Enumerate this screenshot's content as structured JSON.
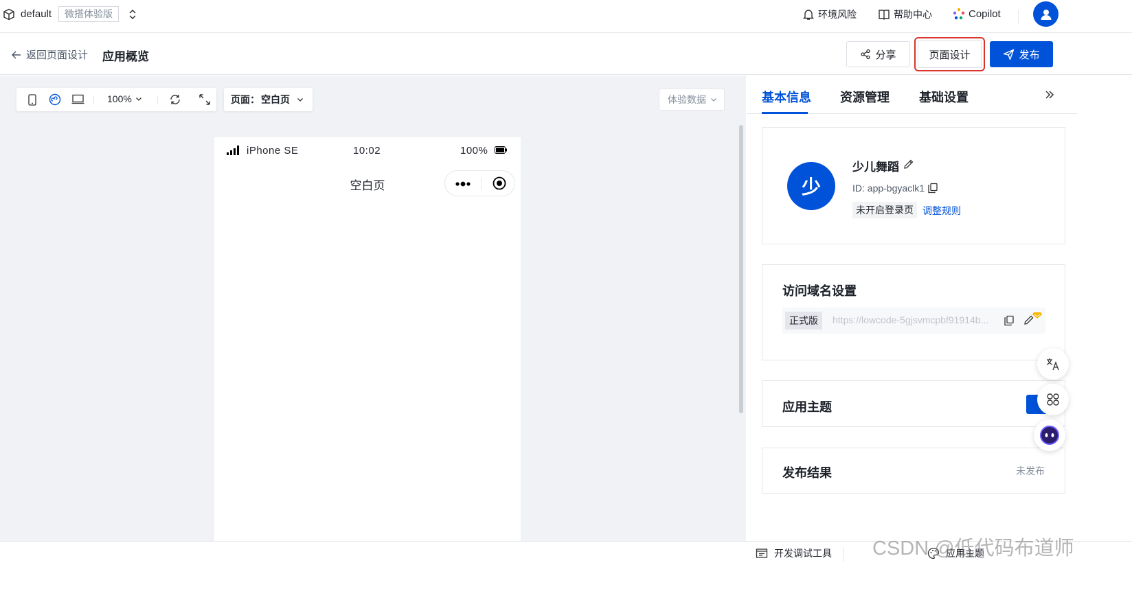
{
  "topbar": {
    "env_name": "default",
    "env_badge": "微搭体验版",
    "links": [
      {
        "label": "环境风险",
        "icon": "bell-icon"
      },
      {
        "label": "帮助中心",
        "icon": "book-icon"
      },
      {
        "label": "Copilot",
        "icon": "copilot-icon"
      }
    ],
    "avatar_icon": "user-icon"
  },
  "subbar": {
    "back_label": "返回页面设计",
    "title": "应用概览",
    "share_label": "分享",
    "page_design_label": "页面设计",
    "publish_label": "发布"
  },
  "canvas": {
    "zoom": "100%",
    "page_label": "页面：",
    "page_name": "空白页",
    "experience_data": "体验数据",
    "device": "iPhone SE",
    "time": "10:02",
    "battery": "100%",
    "phone_page_title": "空白页"
  },
  "panel": {
    "tabs": [
      "基本信息",
      "资源管理",
      "基础设置"
    ],
    "active_tab": 0,
    "app": {
      "avatar_char": "少",
      "name": "少儿舞蹈",
      "id": "ID: app-bgyaclk1",
      "login_badge": "未开启登录页",
      "adjust_link": "调整规则"
    },
    "domain": {
      "title": "访问域名设置",
      "env_label": "正式版",
      "url": "https://lowcode-5gjsvmcpbf91914b..."
    },
    "theme": {
      "title": "应用主题"
    },
    "publish_result": {
      "title": "发布结果",
      "status": "未发布"
    }
  },
  "bottombar": {
    "devtools_label": "开发调试工具",
    "theme_label": "应用主题",
    "watermark": "CSDN @低代码布道师"
  },
  "colors": {
    "primary": "#0052d9",
    "highlight_border": "#d9342b",
    "canvas_bg": "#f1f2f5"
  }
}
